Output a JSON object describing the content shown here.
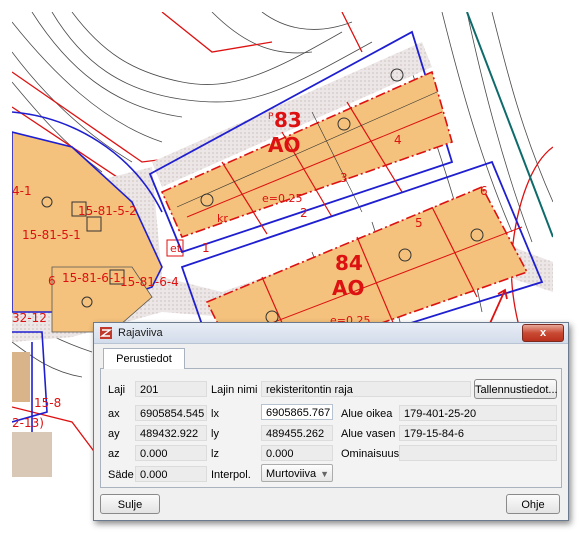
{
  "map": {
    "block_labels": {
      "block83_number": "83",
      "block83_zone": "AO",
      "block84_number": "84",
      "block84_zone": "AO",
      "efficiency_top": "e=0.25",
      "efficiency_bottom": "e=0.25",
      "kr": "kr",
      "et": "et",
      "p": "P"
    },
    "point_numbers": [
      "1",
      "2",
      "3",
      "4",
      "5",
      "6"
    ],
    "parcel_labels": [
      "15-81-5-2",
      "15-81-5-1",
      "15-81-6-1",
      "15-81-6-4",
      "4-1",
      "6",
      "15-8",
      "2-13)",
      "32-12"
    ],
    "colors": {
      "parcel_fill": "#f4c27c",
      "road_fill": "#dcd4d4",
      "boundary_blue": "#1f1fd0",
      "boundary_red": "#dd1111",
      "contour": "#4a4a4a",
      "teal_line": "#0d6b6b"
    }
  },
  "dialog": {
    "title": "Rajaviiva",
    "close_label": "x",
    "tab_label": "Perustiedot",
    "laji_label": "Laji",
    "laji_value": "201",
    "lajinimi_label": "Lajin nimi",
    "lajinimi_value": "rekisteritontin raja",
    "details_button": "Tallennustiedot...",
    "ax_label": "ax",
    "ax_value": "6905854.545",
    "ay_label": "ay",
    "ay_value": "489432.922",
    "az_label": "az",
    "az_value": "0.000",
    "lx_label": "lx",
    "lx_value": "6905865.767",
    "ly_label": "ly",
    "ly_value": "489455.262",
    "lz_label": "lz",
    "lz_value": "0.000",
    "alue_oikea_label": "Alue oikea",
    "alue_oikea_value": "179-401-25-20",
    "alue_vasen_label": "Alue vasen",
    "alue_vasen_value": "179-15-84-6",
    "ominaisuus_label": "Ominaisuus",
    "ominaisuus_value": "",
    "sade_label": "Säde",
    "sade_value": "0.000",
    "interpol_label": "Interpol.",
    "interpol_value": "Murtoviiva",
    "close_button": "Sulje",
    "help_button": "Ohje"
  }
}
